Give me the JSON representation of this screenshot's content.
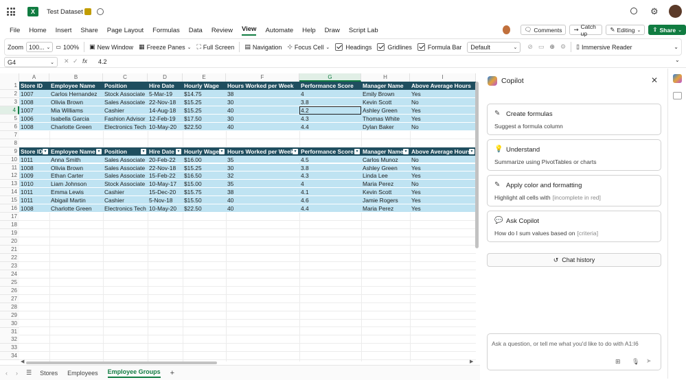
{
  "app": {
    "title": "Test Dataset"
  },
  "menu": [
    "File",
    "Home",
    "Insert",
    "Share",
    "Page Layout",
    "Formulas",
    "Data",
    "Review",
    "View",
    "Automate",
    "Help",
    "Draw",
    "Script Lab"
  ],
  "menu_active": "View",
  "header_buttons": {
    "comments": "Comments",
    "catch_up": "Catch up",
    "editing": "Editing",
    "share": "Share"
  },
  "ribbon": {
    "zoom_label": "Zoom",
    "zoom_value": "100...",
    "zoom100": "100%",
    "new_window": "New Window",
    "freeze_panes": "Freeze Panes",
    "full_screen": "Full Screen",
    "navigation": "Navigation",
    "focus_cell": "Focus Cell",
    "headings": "Headings",
    "gridlines": "Gridlines",
    "formula_bar": "Formula Bar",
    "style_value": "Default",
    "immersive_reader": "Immersive Reader"
  },
  "formula": {
    "name_box": "G4",
    "fx": "fx",
    "value": "4.2"
  },
  "columns": [
    "A",
    "B",
    "C",
    "D",
    "E",
    "F",
    "G",
    "H",
    "I"
  ],
  "table_headers": [
    "Store ID",
    "Employee Name",
    "Position",
    "Hire Date",
    "Hourly Wage",
    "Hours Worked per Week",
    "Performance Score",
    "Manager Name",
    "Above Average Hours"
  ],
  "table1": [
    [
      "1007",
      "Carlos Hernandez",
      "Stock Associate",
      "5-Mar-19",
      "$14.75",
      "38",
      "4",
      "Emily Brown",
      "Yes"
    ],
    [
      "1008",
      "Olivia Brown",
      "Sales Associate",
      "22-Nov-18",
      "$15.25",
      "30",
      "3.8",
      "Kevin Scott",
      "No"
    ],
    [
      "1007",
      "Mia Williams",
      "Cashier",
      "14-Aug-18",
      "$15.25",
      "40",
      "4.2",
      "Ashley Green",
      "Yes"
    ],
    [
      "1006",
      "Isabella Garcia",
      "Fashion Advisor",
      "12-Feb-19",
      "$17.50",
      "30",
      "4.3",
      "Thomas White",
      "Yes"
    ],
    [
      "1008",
      "Charlotte Green",
      "Electronics Tech",
      "10-May-20",
      "$22.50",
      "40",
      "4.4",
      "Dylan Baker",
      "No"
    ]
  ],
  "table2": [
    [
      "1011",
      "Anna Smith",
      "Sales Associate",
      "20-Feb-22",
      "$16.00",
      "35",
      "4.5",
      "Carlos Munoz",
      "No"
    ],
    [
      "1008",
      "Olivia Brown",
      "Sales Associate",
      "22-Nov-18",
      "$15.25",
      "30",
      "3.8",
      "Ashley Green",
      "Yes"
    ],
    [
      "1009",
      "Ethan Carter",
      "Sales Associate",
      "15-Feb-22",
      "$16.50",
      "32",
      "4.3",
      "Linda Lee",
      "Yes"
    ],
    [
      "1010",
      "Liam Johnson",
      "Stock Associate",
      "10-May-17",
      "$15.00",
      "35",
      "4",
      "Maria Perez",
      "No"
    ],
    [
      "1011",
      "Emma Lewis",
      "Cashier",
      "15-Dec-20",
      "$15.75",
      "38",
      "4.1",
      "Kevin Scott",
      "Yes"
    ],
    [
      "1011",
      "Abigail Martin",
      "Cashier",
      "5-Nov-18",
      "$15.50",
      "40",
      "4.6",
      "Jamie Rogers",
      "Yes"
    ],
    [
      "1008",
      "Charlotte Green",
      "Electronics Tech",
      "10-May-20",
      "$22.50",
      "40",
      "4.4",
      "Maria Perez",
      "Yes"
    ]
  ],
  "row_numbers": [
    "1",
    "2",
    "3",
    "4",
    "5",
    "6",
    "7",
    "8",
    "9",
    "10",
    "11",
    "12",
    "13",
    "14",
    "15",
    "16",
    "17",
    "18",
    "19",
    "20",
    "21",
    "22",
    "23",
    "24",
    "25",
    "26",
    "27",
    "28",
    "29",
    "30",
    "31",
    "32",
    "33",
    "34"
  ],
  "copilot": {
    "title": "Copilot",
    "cards": [
      {
        "title": "Create formulas",
        "subtitle": "Suggest a formula column"
      },
      {
        "title": "Understand",
        "subtitle": "Summarize using PivotTables or charts"
      },
      {
        "title": "Apply color and formatting",
        "subtitle": "Highlight all cells with",
        "subtitle_hint": "[incomplete in red]"
      },
      {
        "title": "Ask Copilot",
        "subtitle": "How do I sum values based on",
        "subtitle_hint": "[criteria]"
      }
    ],
    "chat_history": "Chat history",
    "input_placeholder": "Ask a question, or tell me what you'd like to do with A1:I6"
  },
  "sheets": [
    "Stores",
    "Employees",
    "Employee Groups"
  ],
  "active_sheet": "Employee Groups",
  "colors": {
    "header_bg": "#1f4e5f",
    "row_bg": "#bfe3f2",
    "accent": "#107c41",
    "selection": "#e1efe6"
  }
}
